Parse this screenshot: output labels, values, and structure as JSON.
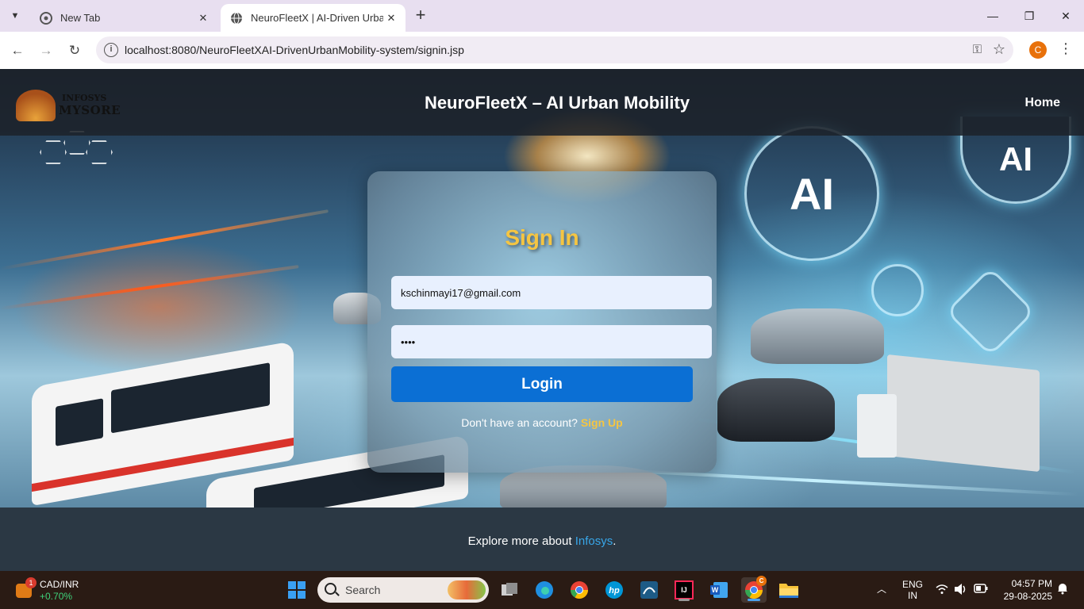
{
  "browser": {
    "tabs": [
      {
        "title": "New Tab"
      },
      {
        "title": "NeuroFleetX | AI-Driven Urban I"
      }
    ],
    "url": "localhost:8080/NeuroFleetXAI-DrivenUrbanMobility-system/signin.jsp",
    "profile_initial": "C"
  },
  "header": {
    "logo_line1": "INFOSYS",
    "logo_line2": "MYSORE",
    "title": "NeuroFleetX – AI Urban Mobility",
    "nav_home": "Home"
  },
  "hero": {
    "ai_text_1": "AI",
    "ai_text_2": "AI"
  },
  "signin": {
    "heading": "Sign In",
    "email_value": "kschinmayi17@gmail.com",
    "password_value": "••••",
    "login_label": "Login",
    "no_account_text": "Don't have an account?",
    "signup_link": "Sign Up"
  },
  "footer": {
    "text_before": "Explore more about ",
    "link_text": "Infosys",
    "text_after": "."
  },
  "taskbar": {
    "widget_badge": "1",
    "widget_name": "CAD/INR",
    "widget_value": "+0.70%",
    "search_placeholder": "Search",
    "chrome_badge": "C",
    "lang_line1": "ENG",
    "lang_line2": "IN",
    "time": "04:57 PM",
    "date": "29-08-2025"
  },
  "colors": {
    "accent_yellow": "#f5c542",
    "login_blue": "#0b6fd4",
    "link_blue": "#38a6e8"
  }
}
